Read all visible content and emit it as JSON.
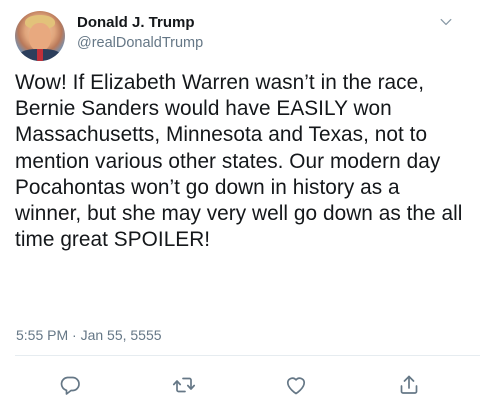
{
  "tweet": {
    "author_name": "Donald J. Trump",
    "author_handle": "@realDonaldTrump",
    "text": "Wow! If Elizabeth Warren wasn’t in the race, Bernie Sanders would have EASILY won Massachusetts, Minnesota and Texas, not to mention various other states. Our modern day Pocahontas won’t go down in history as a winner, but she may very well go down as the all time great SPOILER!",
    "timestamp": "5:55 PM · Jan 55, 5555"
  },
  "icons": {
    "more": "chevron-down-icon",
    "reply": "reply-icon",
    "retweet": "retweet-icon",
    "like": "heart-icon",
    "share": "share-icon"
  },
  "colors": {
    "text": "#14171a",
    "secondary": "#657786",
    "divider": "#e6ecf0"
  }
}
